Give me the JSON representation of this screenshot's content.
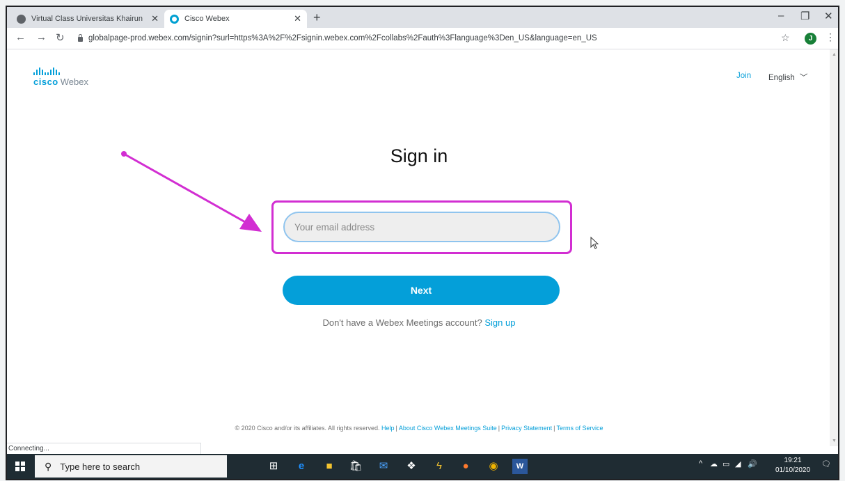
{
  "browser": {
    "tabs": [
      {
        "title": "Virtual Class Universitas Khairun",
        "close": "✕",
        "active": false
      },
      {
        "title": "Cisco Webex",
        "close": "✕",
        "active": true
      }
    ],
    "new_tab": "+",
    "url": "globalpage-prod.webex.com/signin?surl=https%3A%2F%2Fsignin.webex.com%2Fcollabs%2Fauth%3Flanguage%3Den_US&language=en_US",
    "profile_initial": "J",
    "status_text": "Connecting...",
    "window_controls": {
      "minimize": "–",
      "restore": "❐",
      "close": "✕"
    }
  },
  "page": {
    "logo": {
      "cisco": "cisco",
      "webex": "Webex"
    },
    "header": {
      "join_link": "Join",
      "language": "English"
    },
    "title": "Sign in",
    "email_placeholder": "Your email address",
    "next_button": "Next",
    "signup": {
      "prompt": "Don't have a Webex Meetings account?",
      "link": "Sign up"
    },
    "footer": {
      "copyright": "© 2020 Cisco and/or its affiliates. All rights reserved.",
      "links": [
        "Help",
        "About Cisco Webex Meetings Suite",
        "Privacy Statement",
        "Terms of Service"
      ]
    }
  },
  "annotation": {
    "color": "#d22ed2"
  },
  "taskbar": {
    "search_placeholder": "Type here to search",
    "icons": [
      "task-view-icon",
      "edge-icon",
      "file-explorer-icon",
      "store-icon",
      "mail-icon",
      "dropbox-icon",
      "winamp-icon",
      "firefox-icon",
      "chrome-icon",
      "word-icon"
    ],
    "clock_time": "19:21",
    "clock_date": "01/10/2020"
  },
  "colors": {
    "accent": "#049fd9",
    "taskbar": "#1f2c33"
  }
}
